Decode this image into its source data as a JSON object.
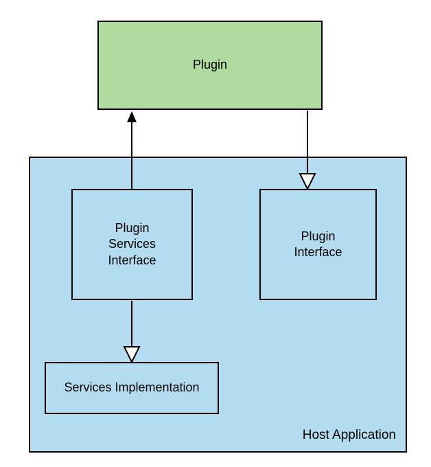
{
  "diagram": {
    "plugin": {
      "label": "Plugin"
    },
    "host": {
      "label": "Host Application"
    },
    "plugin_services_interface": {
      "label": "Plugin\nServices\nInterface"
    },
    "plugin_interface": {
      "label": "Plugin\nInterface"
    },
    "services_implementation": {
      "label": "Services Implementation"
    }
  },
  "colors": {
    "plugin_fill": "#b0daa0",
    "host_fill": "#b3dcf1",
    "stroke": "#000000"
  }
}
